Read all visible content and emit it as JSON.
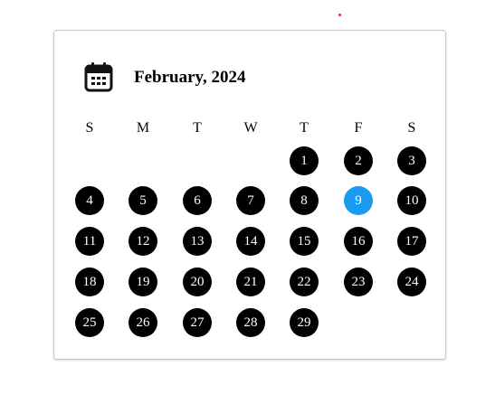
{
  "calendar": {
    "title": "February, 2024",
    "icon": "calendar-icon",
    "weekdays": [
      "S",
      "M",
      "T",
      "W",
      "T",
      "F",
      "S"
    ],
    "first_weekday_index": 4,
    "days": [
      "1",
      "2",
      "3",
      "4",
      "5",
      "6",
      "7",
      "8",
      "9",
      "10",
      "11",
      "12",
      "13",
      "14",
      "15",
      "16",
      "17",
      "18",
      "19",
      "20",
      "21",
      "22",
      "23",
      "24",
      "25",
      "26",
      "27",
      "28",
      "29"
    ],
    "selected_day": "9",
    "colors": {
      "day_bg": "#000000",
      "day_text": "#ffffff",
      "selected_bg": "#1a9bf0"
    }
  }
}
